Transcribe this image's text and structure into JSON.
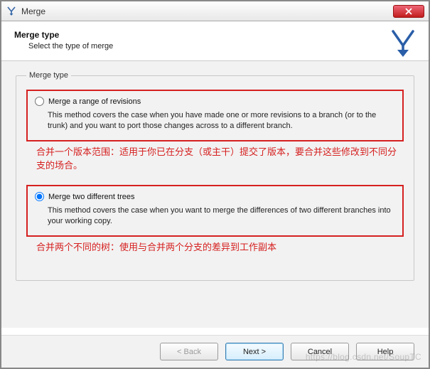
{
  "window": {
    "title": "Merge"
  },
  "header": {
    "title": "Merge type",
    "subtitle": "Select the type of merge"
  },
  "group": {
    "legend": "Merge type",
    "options": [
      {
        "label": "Merge a range of revisions",
        "description": "This method covers the case when you have made one or more revisions to a branch (or to the trunk) and you want to port those changes across to a different branch.",
        "selected": false,
        "annotation": "合并一个版本范围：适用于你已在分支（或主干）提交了版本，要合并这些修改到不同分支的场合。"
      },
      {
        "label": "Merge two different trees",
        "description": "This method covers the case when you want to merge the differences of two different branches into your working copy.",
        "selected": true,
        "annotation": "合并两个不同的树：使用与合并两个分支的差异到工作副本"
      }
    ]
  },
  "buttons": {
    "back": "< Back",
    "next": "Next >",
    "cancel": "Cancel",
    "help": "Help"
  },
  "watermark": "https://blog.csdn.net/SoupTC"
}
